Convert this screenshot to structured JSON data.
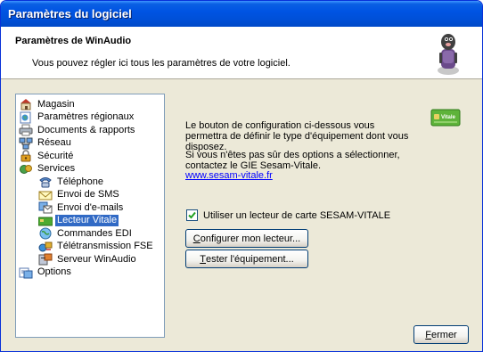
{
  "window": {
    "title": "Paramètres du logiciel"
  },
  "header": {
    "title": "Paramètres de WinAudio",
    "subtitle": "Vous pouvez régler ici tous les paramètres de votre logiciel."
  },
  "tree": {
    "items": [
      {
        "label": "Magasin",
        "icon": "store-icon",
        "level": 0
      },
      {
        "label": "Paramètres régionaux",
        "icon": "regional-settings-icon",
        "level": 0
      },
      {
        "label": "Documents & rapports",
        "icon": "printer-icon",
        "level": 0
      },
      {
        "label": "Réseau",
        "icon": "network-icon",
        "level": 0
      },
      {
        "label": "Sécurité",
        "icon": "security-icon",
        "level": 0
      },
      {
        "label": "Services",
        "icon": "services-icon",
        "level": 0
      },
      {
        "label": "Téléphone",
        "icon": "phone-icon",
        "level": 1
      },
      {
        "label": "Envoi de SMS",
        "icon": "sms-icon",
        "level": 1
      },
      {
        "label": "Envoi d'e-mails",
        "icon": "email-icon",
        "level": 1
      },
      {
        "label": "Lecteur Vitale",
        "icon": "card-reader-icon",
        "level": 1,
        "selected": true
      },
      {
        "label": "Commandes EDI",
        "icon": "globe-icon",
        "level": 1
      },
      {
        "label": "Télétransmission FSE",
        "icon": "transmission-icon",
        "level": 1
      },
      {
        "label": "Serveur WinAudio",
        "icon": "server-icon",
        "level": 1
      },
      {
        "label": "Options",
        "icon": "options-icon",
        "level": 0
      }
    ]
  },
  "panel": {
    "intro": "Le bouton de configuration ci-dessous vous permettra de définir le type d'équipement dont vous disposez.",
    "help": "Si vous n'êtes pas sûr des options a sélectionner, contactez le GIE Sesam-Vitale.",
    "link": "www.sesam-vitale.fr",
    "checkbox_label": "Utiliser un lecteur de carte SESAM-VITALE",
    "checkbox_checked": true,
    "configure_button": {
      "accel": "C",
      "rest": "onfigurer mon lecteur..."
    },
    "test_button": {
      "accel": "T",
      "rest": "ester l'équipement..."
    },
    "vitale_badge": "Vitale"
  },
  "footer": {
    "close_button": {
      "accel": "F",
      "rest": "ermer"
    }
  },
  "colors": {
    "titlebar": "#0054e3",
    "selection": "#316ac5",
    "window_bg": "#ece9d8",
    "link": "#0000ff"
  }
}
